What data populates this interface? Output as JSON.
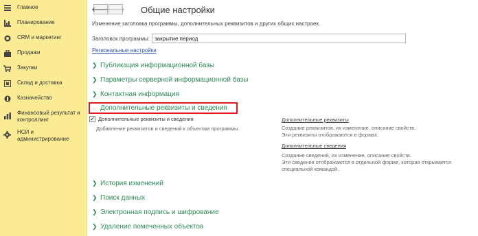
{
  "sidebar": {
    "items": [
      {
        "label": "Главное",
        "icon": "menu-icon"
      },
      {
        "label": "Планирование",
        "icon": "planning-icon"
      },
      {
        "label": "CRM и маркетинг",
        "icon": "crm-icon"
      },
      {
        "label": "Продажи",
        "icon": "sales-icon"
      },
      {
        "label": "Закупки",
        "icon": "cart-icon"
      },
      {
        "label": "Склад и доставка",
        "icon": "warehouse-icon"
      },
      {
        "label": "Казначейство",
        "icon": "treasury-icon"
      },
      {
        "label": "Финансовый результат и контроллинг",
        "icon": "chart-icon"
      },
      {
        "label": "НСИ и администрирование",
        "icon": "gear-icon"
      }
    ]
  },
  "nav": {
    "back": "🡐",
    "forward": "🡒"
  },
  "page": {
    "title": "Общие настройки",
    "description": "Изменение заголовка программы, дополнительных реквизитов и других общих настроек.",
    "header_label": "Заголовок программы:",
    "header_value": "закрытие период",
    "regional_link": "Региональные настройки"
  },
  "sections_before": [
    "Публикация информационной базы",
    "Параметры серверной информационной базы",
    "Контактная информация"
  ],
  "expanded_section": {
    "label": "Дополнительные реквизиты и сведения",
    "checkbox_label": "Дополнительные реквизиты и сведения",
    "checkbox_checked": true,
    "checkbox_desc": "Добавление реквизитов и сведений к объектам программы.",
    "link1": "Дополнительные реквизиты",
    "link1_desc1": "Создание реквизитов, их изменение, описание свойств.",
    "link1_desc2": "Эти реквизиты отображаются в формах.",
    "link2": "Дополнительные сведения",
    "link2_desc1": "Создание сведений, их изменение, описание свойств.",
    "link2_desc2": "Эти сведения отображаются в отдельной форме, которая открывается",
    "link2_desc3": "специальной командой."
  },
  "sections_after": [
    "История изменений",
    "Поиск данных",
    "Электронная подпись и шифрование",
    "Удаление помеченных объектов"
  ],
  "colors": {
    "sidebar_bg": "#fbeb94",
    "section_green": "#2e8b57",
    "link_blue": "#2b4fa8",
    "highlight_red": "#e0191e"
  }
}
